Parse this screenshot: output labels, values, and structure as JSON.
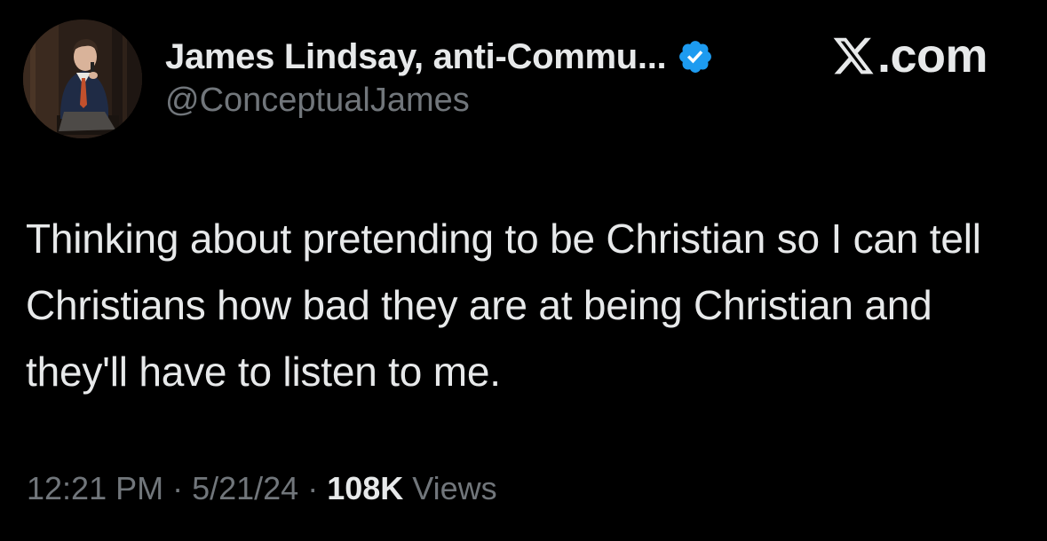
{
  "tweet": {
    "author": {
      "display_name": "James Lindsay, anti-Commu...",
      "handle": "@ConceptualJames",
      "verified_icon": "verified-badge-icon",
      "avatar": "avatar-photo"
    },
    "source": {
      "logo_icon": "x-logo-icon",
      "label": ".com"
    },
    "text": "Thinking about pretending to be Christian so I can tell Christians how bad they are at being Christian and they'll have to listen to me.",
    "meta": {
      "time": "12:21 PM",
      "date": "5/21/24",
      "separator": "·",
      "views_count": "108K",
      "views_label": "Views"
    }
  },
  "colors": {
    "background": "#000000",
    "primary_text": "#e7e9ea",
    "secondary_text": "#71767b",
    "verified_blue": "#1d9bf0"
  }
}
